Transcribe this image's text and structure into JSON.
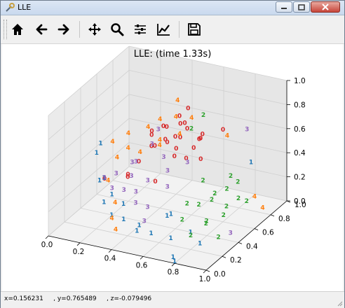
{
  "window": {
    "title": "LLE"
  },
  "toolbar": {
    "buttons": [
      {
        "name": "home",
        "icon": "home-icon"
      },
      {
        "name": "back",
        "icon": "arrow-left-icon"
      },
      {
        "name": "forward",
        "icon": "arrow-right-icon"
      },
      {
        "name": "pan",
        "icon": "move-icon"
      },
      {
        "name": "zoom",
        "icon": "zoom-icon"
      },
      {
        "name": "subplots",
        "icon": "sliders-icon"
      },
      {
        "name": "customize",
        "icon": "line-chart-icon"
      },
      {
        "name": "save",
        "icon": "save-icon"
      }
    ]
  },
  "status": {
    "coords": "x=0.156231     , y=0.765489     , z=-0.079496"
  },
  "chart_data": {
    "type": "scatter",
    "projection": "3d",
    "title": "LLE: (time 1.33s)",
    "marker": "digit labels 0-4",
    "xlim": [
      0.0,
      1.0
    ],
    "ylim": [
      0.0,
      1.0
    ],
    "zlim": [
      0.0,
      1.0
    ],
    "x_ticks": [
      "0.0",
      "0.2",
      "0.4",
      "0.6",
      "0.8",
      "1.0"
    ],
    "y_ticks": [
      "0.0",
      "0.2",
      "0.4",
      "0.6",
      "0.8",
      "1.0"
    ],
    "z_ticks": [
      "0.0",
      "0.2",
      "0.4",
      "0.6",
      "0.8",
      "1.0"
    ],
    "grid": true,
    "class_colors": {
      "0": "#d62728",
      "1": "#1f77b4",
      "2": "#2ca02c",
      "3": "#9467bd",
      "4": "#ff7f0e"
    },
    "points": [
      {
        "label": "0",
        "x": 0.55,
        "y": 0.35,
        "z": 0.85
      },
      {
        "label": "0",
        "x": 0.6,
        "y": 0.4,
        "z": 0.75
      },
      {
        "label": "0",
        "x": 0.5,
        "y": 0.3,
        "z": 0.7
      },
      {
        "label": "0",
        "x": 0.65,
        "y": 0.45,
        "z": 0.8
      },
      {
        "label": "0",
        "x": 0.58,
        "y": 0.5,
        "z": 0.68
      },
      {
        "label": "0",
        "x": 0.52,
        "y": 0.45,
        "z": 0.78
      },
      {
        "label": "0",
        "x": 0.62,
        "y": 0.35,
        "z": 0.62
      },
      {
        "label": "0",
        "x": 0.45,
        "y": 0.4,
        "z": 0.72
      },
      {
        "label": "0",
        "x": 0.7,
        "y": 0.5,
        "z": 0.7
      },
      {
        "label": "0",
        "x": 0.55,
        "y": 0.55,
        "z": 0.82
      },
      {
        "label": "0",
        "x": 0.48,
        "y": 0.38,
        "z": 0.65
      },
      {
        "label": "0",
        "x": 0.66,
        "y": 0.4,
        "z": 0.88
      },
      {
        "label": "0",
        "x": 0.6,
        "y": 0.3,
        "z": 0.76
      },
      {
        "label": "0",
        "x": 0.72,
        "y": 0.3,
        "z": 0.66
      },
      {
        "label": "0",
        "x": 0.57,
        "y": 0.47,
        "z": 0.6
      },
      {
        "label": "0",
        "x": 0.53,
        "y": 0.6,
        "z": 0.72
      },
      {
        "label": "0",
        "x": 0.46,
        "y": 0.55,
        "z": 0.6
      },
      {
        "label": "0",
        "x": 0.64,
        "y": 0.55,
        "z": 0.58
      },
      {
        "label": "0",
        "x": 0.8,
        "y": 0.6,
        "z": 0.75
      },
      {
        "label": "0",
        "x": 0.35,
        "y": 0.3,
        "z": 0.4
      },
      {
        "label": "0",
        "x": 0.3,
        "y": 0.4,
        "z": 0.35
      },
      {
        "label": "0",
        "x": 0.55,
        "y": 0.25,
        "z": 0.45
      },
      {
        "label": "0",
        "x": 0.42,
        "y": 0.3,
        "z": 0.55
      },
      {
        "label": "0",
        "x": 0.1,
        "y": 0.5,
        "z": 0.2
      },
      {
        "label": "0",
        "x": 0.66,
        "y": 0.62,
        "z": 0.66
      },
      {
        "label": "0",
        "x": 0.72,
        "y": 0.48,
        "z": 0.55
      },
      {
        "label": "0",
        "x": 0.76,
        "y": 0.4,
        "z": 0.78
      },
      {
        "label": "0",
        "x": 0.62,
        "y": 0.52,
        "z": 0.92
      },
      {
        "label": "0",
        "x": 0.4,
        "y": 0.5,
        "z": 0.68
      },
      {
        "label": "1",
        "x": 0.05,
        "y": 0.55,
        "z": 0.45
      },
      {
        "label": "1",
        "x": 0.05,
        "y": 0.5,
        "z": 0.4
      },
      {
        "label": "1",
        "x": 0.12,
        "y": 0.4,
        "z": 0.25
      },
      {
        "label": "1",
        "x": 0.45,
        "y": 0.05,
        "z": 0.35
      },
      {
        "label": "1",
        "x": 0.35,
        "y": 0.1,
        "z": 0.2
      },
      {
        "label": "1",
        "x": 0.55,
        "y": 0.05,
        "z": 0.2
      },
      {
        "label": "1",
        "x": 0.75,
        "y": 0.05,
        "z": 0.15
      },
      {
        "label": "1",
        "x": 0.6,
        "y": 0.1,
        "z": 0.12
      },
      {
        "label": "1",
        "x": 0.3,
        "y": 0.2,
        "z": 0.3
      },
      {
        "label": "1",
        "x": 0.2,
        "y": 0.3,
        "z": 0.35
      },
      {
        "label": "1",
        "x": 0.5,
        "y": 0.12,
        "z": 0.1
      },
      {
        "label": "1",
        "x": 0.85,
        "y": 0.1,
        "z": 0.2
      },
      {
        "label": "1",
        "x": 0.95,
        "y": 0.02,
        "z": 0.18
      },
      {
        "label": "1",
        "x": 0.4,
        "y": 0.15,
        "z": 0.15
      },
      {
        "label": "1",
        "x": 0.65,
        "y": 0.2,
        "z": 0.22
      },
      {
        "label": "1",
        "x": 0.25,
        "y": 0.2,
        "z": 0.22
      },
      {
        "label": "1",
        "x": 0.7,
        "y": 0.15,
        "z": 0.28
      },
      {
        "label": "1",
        "x": 0.85,
        "y": 0.85,
        "z": 0.35
      },
      {
        "label": "1",
        "x": 0.78,
        "y": 0.02,
        "z": 0.02
      },
      {
        "label": "1",
        "x": 0.8,
        "y": 0.0,
        "z": 0.0
      },
      {
        "label": "2",
        "x": 0.9,
        "y": 0.5,
        "z": 0.45
      },
      {
        "label": "2",
        "x": 0.85,
        "y": 0.4,
        "z": 0.35
      },
      {
        "label": "2",
        "x": 0.8,
        "y": 0.3,
        "z": 0.3
      },
      {
        "label": "2",
        "x": 0.95,
        "y": 0.35,
        "z": 0.3
      },
      {
        "label": "2",
        "x": 0.75,
        "y": 0.45,
        "z": 0.4
      },
      {
        "label": "2",
        "x": 0.85,
        "y": 0.55,
        "z": 0.3
      },
      {
        "label": "2",
        "x": 0.9,
        "y": 0.2,
        "z": 0.25
      },
      {
        "label": "2",
        "x": 0.7,
        "y": 0.35,
        "z": 0.25
      },
      {
        "label": "2",
        "x": 0.95,
        "y": 0.6,
        "z": 0.2
      },
      {
        "label": "2",
        "x": 0.8,
        "y": 0.2,
        "z": 0.1
      },
      {
        "label": "2",
        "x": 0.88,
        "y": 0.45,
        "z": 0.15
      },
      {
        "label": "2",
        "x": 0.72,
        "y": 0.25,
        "z": 0.18
      },
      {
        "label": "2",
        "x": 1.0,
        "y": 0.4,
        "z": 0.35
      },
      {
        "label": "2",
        "x": 0.95,
        "y": 0.25,
        "z": 0.1
      },
      {
        "label": "2",
        "x": 0.78,
        "y": 0.5,
        "z": 0.22
      },
      {
        "label": "2",
        "x": 0.6,
        "y": 0.6,
        "z": 0.7
      },
      {
        "label": "2",
        "x": 0.65,
        "y": 0.65,
        "z": 0.8
      },
      {
        "label": "2",
        "x": 0.92,
        "y": 0.55,
        "z": 0.38
      },
      {
        "label": "2",
        "x": 0.82,
        "y": 0.35,
        "z": 0.12
      },
      {
        "label": "3",
        "x": 0.25,
        "y": 0.55,
        "z": 0.35
      },
      {
        "label": "3",
        "x": 0.3,
        "y": 0.5,
        "z": 0.4
      },
      {
        "label": "3",
        "x": 0.4,
        "y": 0.45,
        "z": 0.3
      },
      {
        "label": "3",
        "x": 0.35,
        "y": 0.6,
        "z": 0.5
      },
      {
        "label": "3",
        "x": 0.45,
        "y": 0.55,
        "z": 0.45
      },
      {
        "label": "3",
        "x": 0.2,
        "y": 0.45,
        "z": 0.3
      },
      {
        "label": "3",
        "x": 0.5,
        "y": 0.5,
        "z": 0.38
      },
      {
        "label": "3",
        "x": 0.3,
        "y": 0.35,
        "z": 0.25
      },
      {
        "label": "3",
        "x": 0.4,
        "y": 0.3,
        "z": 0.2
      },
      {
        "label": "3",
        "x": 0.25,
        "y": 0.3,
        "z": 0.28
      },
      {
        "label": "3",
        "x": 0.35,
        "y": 0.4,
        "z": 0.22
      },
      {
        "label": "3",
        "x": 0.55,
        "y": 0.4,
        "z": 0.32
      },
      {
        "label": "3",
        "x": 0.15,
        "y": 0.4,
        "z": 0.28
      },
      {
        "label": "3",
        "x": 0.45,
        "y": 0.35,
        "z": 0.15
      },
      {
        "label": "3",
        "x": 0.6,
        "y": 0.55,
        "z": 0.45
      },
      {
        "label": "3",
        "x": 0.95,
        "y": 0.4,
        "z": 0.05
      },
      {
        "label": "3",
        "x": 0.85,
        "y": 0.8,
        "z": 0.65
      },
      {
        "label": "3",
        "x": 0.38,
        "y": 0.62,
        "z": 0.62
      },
      {
        "label": "3",
        "x": 0.48,
        "y": 0.25,
        "z": 0.1
      },
      {
        "label": "3",
        "x": 0.22,
        "y": 0.6,
        "z": 0.2
      },
      {
        "label": "4",
        "x": 0.1,
        "y": 0.6,
        "z": 0.45
      },
      {
        "label": "4",
        "x": 0.2,
        "y": 0.6,
        "z": 0.55
      },
      {
        "label": "4",
        "x": 0.3,
        "y": 0.65,
        "z": 0.6
      },
      {
        "label": "4",
        "x": 0.4,
        "y": 0.6,
        "z": 0.55
      },
      {
        "label": "4",
        "x": 0.35,
        "y": 0.7,
        "z": 0.65
      },
      {
        "label": "4",
        "x": 0.45,
        "y": 0.7,
        "z": 0.7
      },
      {
        "label": "4",
        "x": 0.25,
        "y": 0.5,
        "z": 0.5
      },
      {
        "label": "4",
        "x": 0.5,
        "y": 0.65,
        "z": 0.6
      },
      {
        "label": "4",
        "x": 0.3,
        "y": 0.55,
        "z": 0.45
      },
      {
        "label": "4",
        "x": 0.2,
        "y": 0.35,
        "z": 0.3
      },
      {
        "label": "4",
        "x": 0.3,
        "y": 0.2,
        "z": 0.1
      },
      {
        "label": "4",
        "x": 0.35,
        "y": 0.15,
        "z": 0.05
      },
      {
        "label": "4",
        "x": 1.0,
        "y": 0.6,
        "z": 0.25
      },
      {
        "label": "4",
        "x": 1.0,
        "y": 0.7,
        "z": 0.1
      },
      {
        "label": "4",
        "x": 0.75,
        "y": 0.75,
        "z": 0.6
      },
      {
        "label": "4",
        "x": 0.45,
        "y": 0.5,
        "z": 0.58
      },
      {
        "label": "4",
        "x": 0.55,
        "y": 0.7,
        "z": 0.72
      },
      {
        "label": "4",
        "x": 0.18,
        "y": 0.5,
        "z": 0.4
      },
      {
        "label": "4",
        "x": 0.42,
        "y": 0.78,
        "z": 0.78
      },
      {
        "label": "4",
        "x": 0.28,
        "y": 0.28,
        "z": 0.18
      }
    ]
  }
}
